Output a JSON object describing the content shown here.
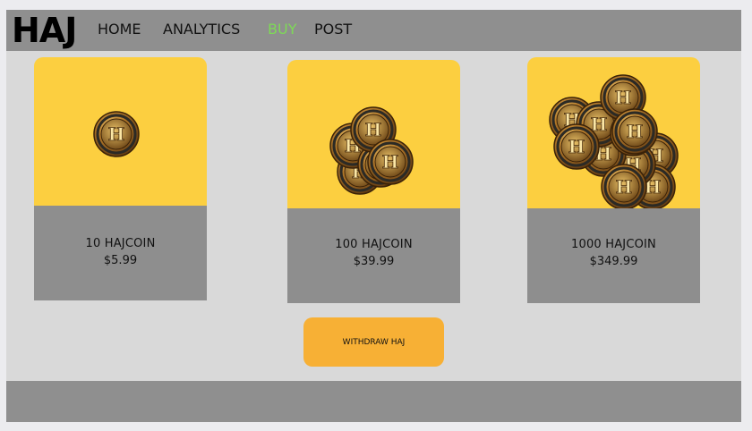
{
  "header": {
    "logo": "HAJ",
    "nav": [
      {
        "label": "HOME"
      },
      {
        "label": "ANALYTICS"
      },
      {
        "label": "BUY"
      },
      {
        "label": "POST"
      }
    ],
    "active_color": "#7ed957"
  },
  "products": [
    {
      "name": "10 HAJCOIN",
      "price": "$5.99",
      "icon": "single-coin-icon"
    },
    {
      "name": "100 HAJCOIN",
      "price": "$39.99",
      "icon": "coin-stack-icon"
    },
    {
      "name": "1000 HAJCOIN",
      "price": "$349.99",
      "icon": "coin-pile-icon"
    }
  ],
  "withdraw": {
    "label": "WITHDRAW HAJ"
  },
  "colors": {
    "card_image_bg": "#fccf40",
    "card_info_bg": "#8e8e8e",
    "withdraw_bg": "#f7b035",
    "bar_bg": "#8f8f8f",
    "page_bg": "#d9d9d9"
  }
}
